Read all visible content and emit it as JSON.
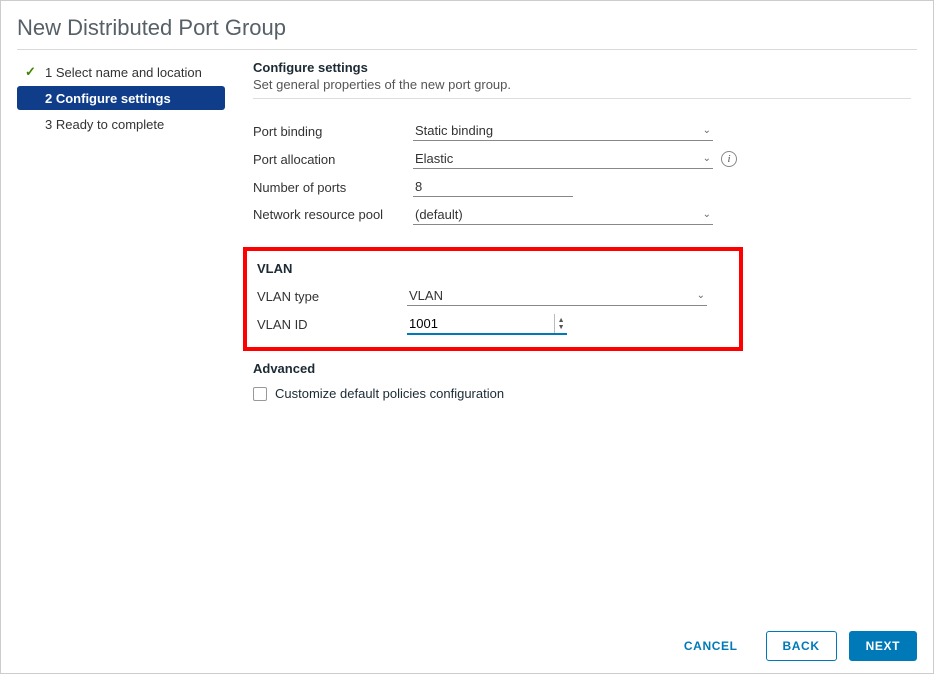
{
  "title": "New Distributed Port Group",
  "steps": {
    "s1": {
      "label": "1 Select name and location"
    },
    "s2": {
      "label": "2 Configure settings"
    },
    "s3": {
      "label": "3 Ready to complete"
    }
  },
  "section": {
    "heading": "Configure settings",
    "desc": "Set general properties of the new port group."
  },
  "fields": {
    "port_binding_label": "Port binding",
    "port_binding_value": "Static binding",
    "port_alloc_label": "Port allocation",
    "port_alloc_value": "Elastic",
    "num_ports_label": "Number of ports",
    "num_ports_value": "8",
    "nrp_label": "Network resource pool",
    "nrp_value": "(default)"
  },
  "vlan": {
    "heading": "VLAN",
    "type_label": "VLAN type",
    "type_value": "VLAN",
    "id_label": "VLAN ID",
    "id_value": "1001"
  },
  "advanced": {
    "heading": "Advanced",
    "checkbox_label": "Customize default policies configuration"
  },
  "buttons": {
    "cancel": "CANCEL",
    "back": "BACK",
    "next": "NEXT"
  }
}
